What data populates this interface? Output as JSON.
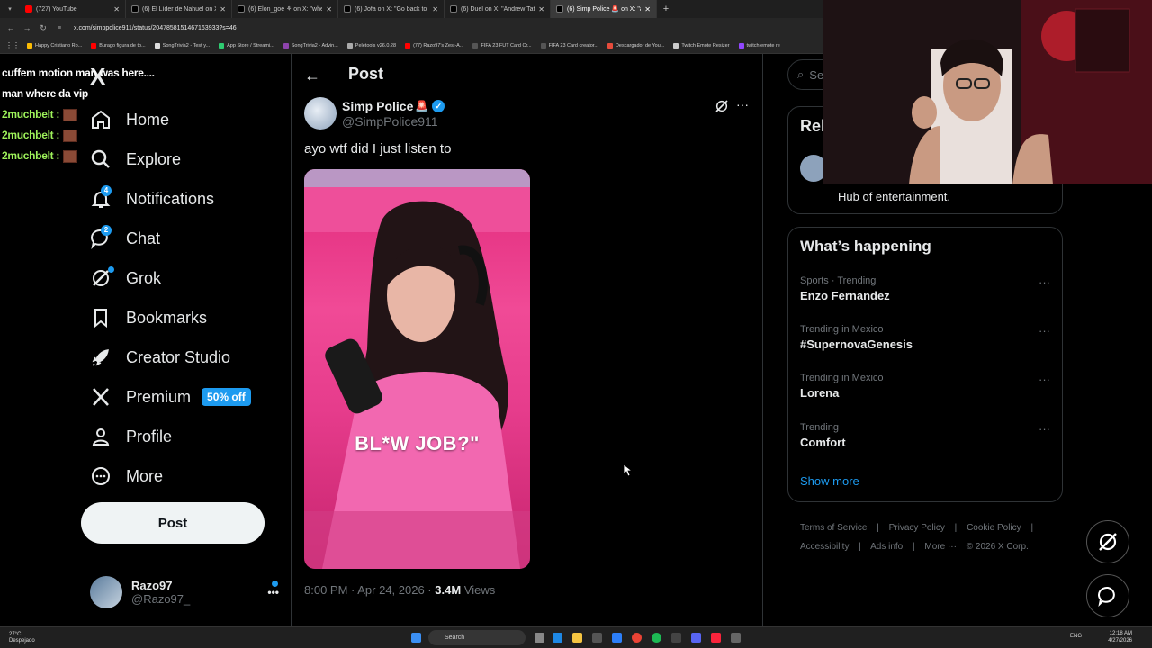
{
  "browser": {
    "tabs": [
      {
        "title": "(727) YouTube",
        "color": "#ff0000"
      },
      {
        "title": "(6) El Líder de Nahuel on X: \"Cu",
        "color": "#e7e9ea"
      },
      {
        "title": "(6) Elon_goe ⚘ on X: \"when to",
        "color": "#e7e9ea"
      },
      {
        "title": "(6) Jofa on X: \"Go back to you",
        "color": "#e7e9ea"
      },
      {
        "title": "(6) Duel on X: \"Andrew Tate m",
        "color": "#e7e9ea"
      },
      {
        "title": "(6) Simp Police 🚨 on X: \"ay",
        "color": "#e7e9ea",
        "active": true
      }
    ],
    "new_tab": "+",
    "url": "x.com/simppolice911/status/2047858151467163933?s=46",
    "bookmarks": [
      "Happy Cristiano Ro...",
      "Burago figura de to...",
      "SongTrivia2 - Test y...",
      "App Store / Streami...",
      "SongTrivia2 - Advin...",
      "Peletools v26.0.28",
      "(77) Razo97's Zest-A...",
      "FIFA 23 FUT Card Cr...",
      "FIFA 23 Card creator...",
      "Descargador de You...",
      "Twitch Emote Resizer",
      "twitch emote re"
    ]
  },
  "stream_chat": [
    {
      "user": "",
      "msg": "cuffem motion man was here...."
    },
    {
      "user": "",
      "msg": "man where da vip"
    },
    {
      "user": "2muchbelt :",
      "msg": ""
    },
    {
      "user": "2muchbelt :",
      "msg": ""
    },
    {
      "user": "2muchbelt :",
      "msg": ""
    }
  ],
  "sidebar": {
    "logo": "X",
    "items": [
      {
        "label": "Home",
        "icon": "home-icon"
      },
      {
        "label": "Explore",
        "icon": "search-icon"
      },
      {
        "label": "Notifications",
        "icon": "bell-icon",
        "badge": "4"
      },
      {
        "label": "Chat",
        "icon": "chat-icon",
        "badge": "2"
      },
      {
        "label": "Grok",
        "icon": "grok-icon"
      },
      {
        "label": "Bookmarks",
        "icon": "bookmark-icon"
      },
      {
        "label": "Creator Studio",
        "icon": "rocket-icon"
      },
      {
        "label": "Premium",
        "icon": "x-icon",
        "pill": "50% off"
      },
      {
        "label": "Profile",
        "icon": "person-icon"
      },
      {
        "label": "More",
        "icon": "more-circle-icon"
      }
    ],
    "post_button": "Post",
    "account": {
      "name": "Razo97",
      "handle": "@Razo97_",
      "more": "•••"
    }
  },
  "main": {
    "header_title": "Post",
    "back": "←",
    "post": {
      "author": "Simp Police",
      "siren": "🚨",
      "verified": "✓",
      "handle": "@SimpPolice911",
      "text": "ayo wtf did I just listen to",
      "media_caption": "BL*W JOB?\"",
      "time": "8:00 PM · Apr 24, 2026 · ",
      "views_count": "3.4M",
      "views_label": " Views",
      "more": "···"
    }
  },
  "right": {
    "search_placeholder": "Se",
    "relevant_title": "Rel",
    "relevant_desc": "Hub of entertainment.",
    "happening_title": "What’s happening",
    "trends": [
      {
        "context": "Sports · Trending",
        "name": "Enzo Fernandez"
      },
      {
        "context": "Trending in Mexico",
        "name": "#SupernovaGenesis"
      },
      {
        "context": "Trending in Mexico",
        "name": "Lorena"
      },
      {
        "context": "Trending",
        "name": "Comfort"
      }
    ],
    "trend_more": "···",
    "show_more": "Show more",
    "footer_row1": [
      "Terms of Service",
      "|",
      "Privacy Policy",
      "|",
      "Cookie Policy",
      "|"
    ],
    "footer_row2": [
      "Accessibility",
      "|",
      "Ads info",
      "|",
      "More ···",
      "© 2026 X Corp."
    ]
  },
  "taskbar": {
    "weather_temp": "27°C",
    "weather_desc": "Despejado",
    "search": "Search",
    "lang": "ENG",
    "time": "12:18 AM",
    "date": "4/27/2026"
  },
  "colors": {
    "accent": "#1d9bf0",
    "bg": "#000000",
    "muted": "#71767b",
    "text": "#e7e9ea",
    "chat_user": "#9ef25a"
  }
}
